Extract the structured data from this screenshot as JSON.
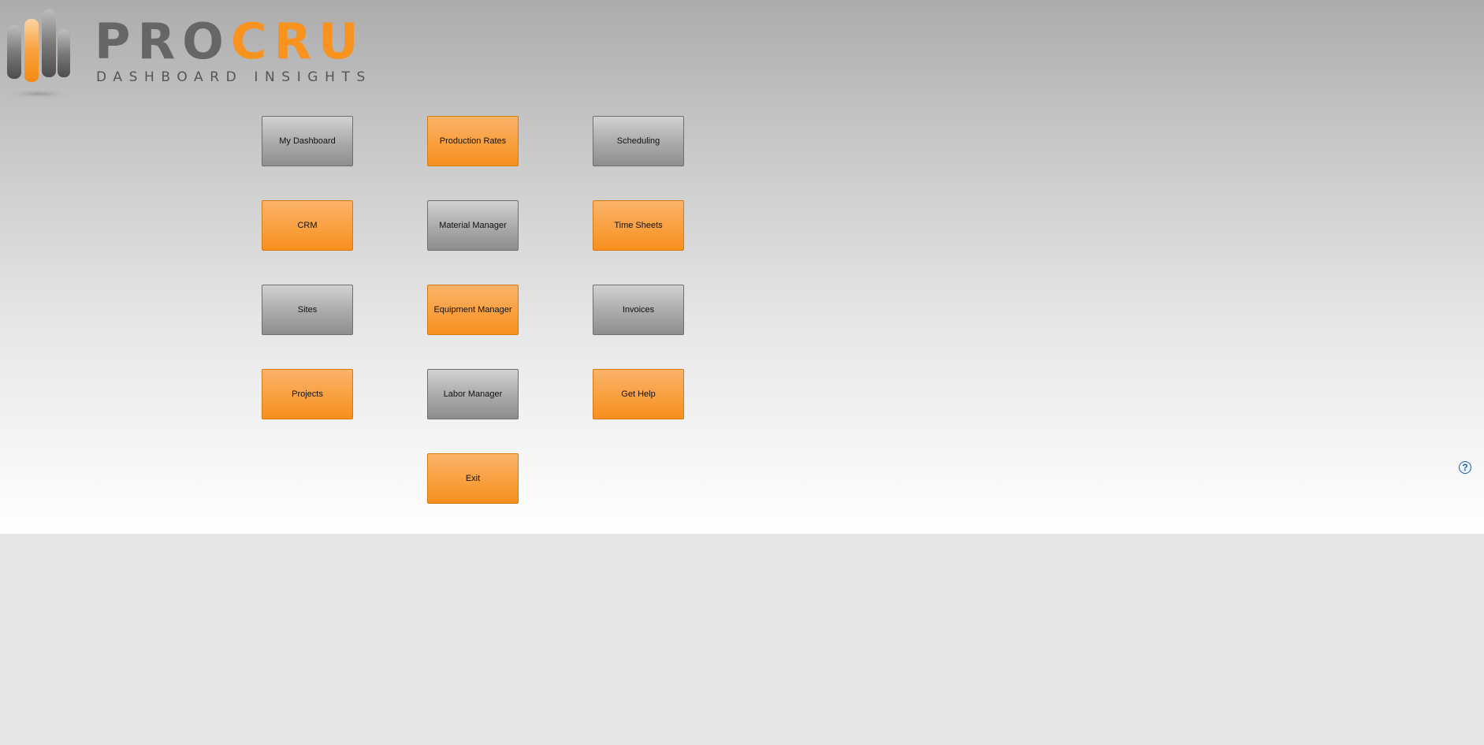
{
  "logo": {
    "word_pro": "PRO",
    "word_cru": "CRU",
    "tagline": "DASHBOARD INSIGHTS",
    "colors": {
      "gray": "#666666",
      "orange": "#f7931e"
    }
  },
  "tiles": [
    {
      "label": "My Dashboard",
      "color": "gray"
    },
    {
      "label": "Production Rates",
      "color": "orange"
    },
    {
      "label": "Scheduling",
      "color": "gray"
    },
    {
      "label": "CRM",
      "color": "orange"
    },
    {
      "label": "Material Manager",
      "color": "gray"
    },
    {
      "label": "Time Sheets",
      "color": "orange"
    },
    {
      "label": "Sites",
      "color": "gray"
    },
    {
      "label": "Equipment Manager",
      "color": "orange"
    },
    {
      "label": "Invoices",
      "color": "gray"
    },
    {
      "label": "Projects",
      "color": "orange"
    },
    {
      "label": "Labor Manager",
      "color": "gray"
    },
    {
      "label": "Get Help",
      "color": "orange"
    },
    {
      "label": "Exit",
      "color": "orange"
    }
  ],
  "help": {
    "icon": "help-icon",
    "glyph": "?"
  }
}
